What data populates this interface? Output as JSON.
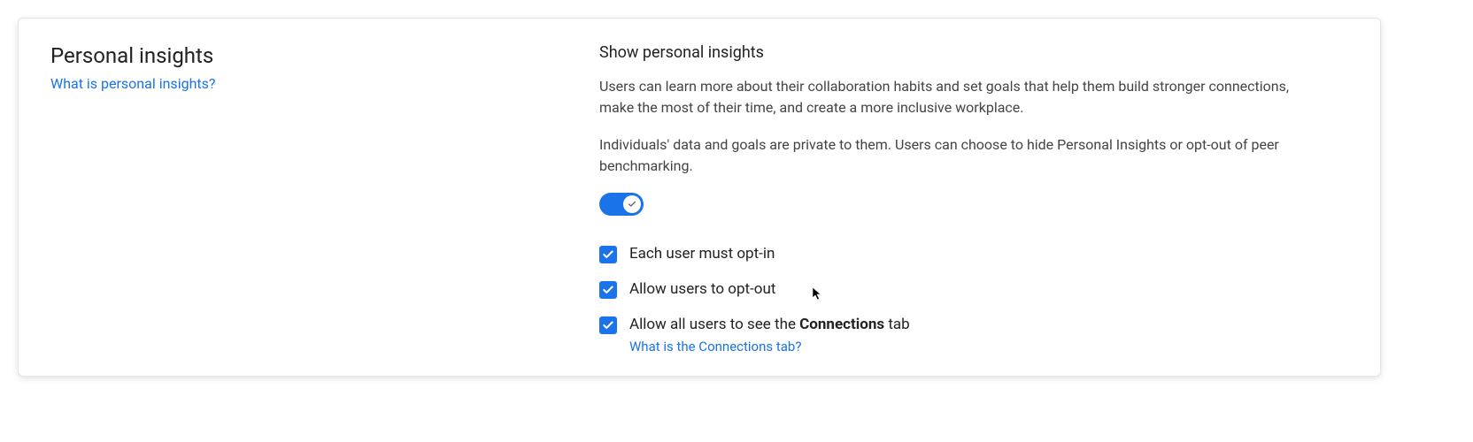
{
  "section": {
    "title": "Personal insights",
    "helpLink": "What is personal insights?"
  },
  "setting": {
    "title": "Show personal insights",
    "description1": "Users can learn more about their collaboration habits and set goals that help them build stronger connections, make the most of their time, and create a more inclusive workplace.",
    "description2": "Individuals' data and goals are private to them. Users can choose to hide Personal Insights or opt-out of peer benchmarking.",
    "toggleOn": true
  },
  "options": [
    {
      "label": "Each user must opt-in",
      "checked": true
    },
    {
      "label": "Allow users to opt-out",
      "checked": true
    },
    {
      "labelPrefix": "Allow all users to see the ",
      "labelBold": "Connections",
      "labelSuffix": " tab",
      "checked": true,
      "subLink": "What is the Connections tab?"
    }
  ]
}
